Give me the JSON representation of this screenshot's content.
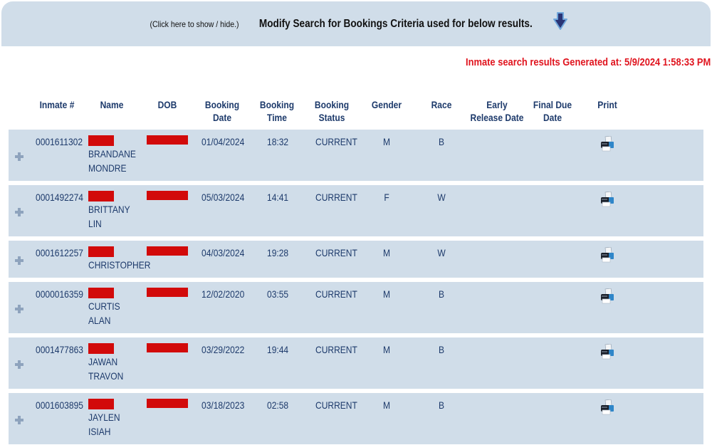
{
  "criteria": {
    "hint": "(Click here to show / hide.)",
    "title": "Modify Search for Bookings Criteria used for below results.",
    "icon": "down-arrow-icon"
  },
  "generated": "Inmate search results Generated at: 5/9/2024 1:58:33 PM",
  "colors": {
    "panel": "#d0dde9",
    "text": "#1d3a6b",
    "alert": "#e0141e",
    "redaction": "#d20a0a"
  },
  "table": {
    "headers": {
      "inmate": "Inmate #",
      "name": "Name",
      "dob": "DOB",
      "booking_date": "Booking Date",
      "booking_time_1": "Booking",
      "booking_time_2": "Time",
      "booking_status_1": "Booking",
      "booking_status_2": "Status",
      "gender": "Gender",
      "race": "Race",
      "early_release_1": "Early",
      "early_release_2": "Release Date",
      "final_due_1": "Final Due",
      "final_due_2": "Date",
      "print": "Print"
    },
    "rows": [
      {
        "inmate": "0001611302",
        "name_line1": "BRANDANE",
        "name_line2": "MONDRE",
        "booking_date": "01/04/2024",
        "booking_time": "18:32",
        "status": "CURRENT",
        "gender": "M",
        "race": "B",
        "early_release": "",
        "final_due": ""
      },
      {
        "inmate": "0001492274",
        "name_line1": "BRITTANY",
        "name_line2": "LIN",
        "booking_date": "05/03/2024",
        "booking_time": "14:41",
        "status": "CURRENT",
        "gender": "F",
        "race": "W",
        "early_release": "",
        "final_due": ""
      },
      {
        "inmate": "0001612257",
        "name_line1": "CHRISTOPHER",
        "name_line2": "",
        "booking_date": "04/03/2024",
        "booking_time": "19:28",
        "status": "CURRENT",
        "gender": "M",
        "race": "W",
        "early_release": "",
        "final_due": ""
      },
      {
        "inmate": "0000016359",
        "name_line1": "CURTIS",
        "name_line2": "ALAN",
        "booking_date": "12/02/2020",
        "booking_time": "03:55",
        "status": "CURRENT",
        "gender": "M",
        "race": "B",
        "early_release": "",
        "final_due": ""
      },
      {
        "inmate": "0001477863",
        "name_line1": "JAWAN",
        "name_line2": "TRAVON",
        "booking_date": "03/29/2022",
        "booking_time": "19:44",
        "status": "CURRENT",
        "gender": "M",
        "race": "B",
        "early_release": "",
        "final_due": ""
      },
      {
        "inmate": "0001603895",
        "name_line1": "JAYLEN",
        "name_line2": "ISIAH",
        "booking_date": "03/18/2023",
        "booking_time": "02:58",
        "status": "CURRENT",
        "gender": "M",
        "race": "B",
        "early_release": "",
        "final_due": ""
      }
    ]
  }
}
